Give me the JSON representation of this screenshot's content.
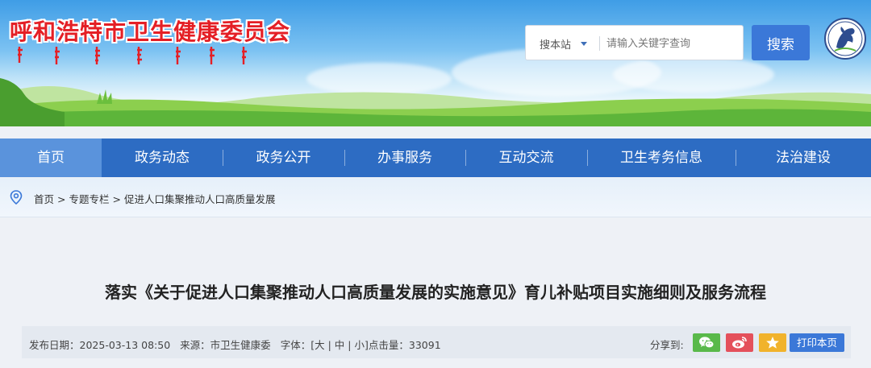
{
  "header": {
    "site_title": "呼和浩特市卫生健康委员会",
    "emblem_icon": "horse-emblem-icon"
  },
  "search": {
    "scope_label": "搜本站",
    "placeholder": "请输入关键字查询",
    "button_label": "搜索"
  },
  "nav": {
    "items": [
      {
        "label": "首页",
        "active": true
      },
      {
        "label": "政务动态"
      },
      {
        "label": "政务公开"
      },
      {
        "label": "办事服务"
      },
      {
        "label": "互动交流"
      },
      {
        "label": "卫生考务信息"
      },
      {
        "label": "法治建设"
      }
    ]
  },
  "breadcrumb": {
    "icon": "location-pin-icon",
    "items": [
      "首页",
      "专题专栏",
      "促进人口集聚推动人口高质量发展"
    ],
    "separator": ">"
  },
  "article": {
    "title": "落实《关于促进人口集聚推动人口高质量发展的实施意见》育儿补贴项目实施细则及服务流程",
    "meta": {
      "publish_label": "发布日期：",
      "publish_date": "2025-03-13 08:50",
      "source_label": "来源：",
      "source": "市卫生健康委",
      "font_label": "字体：",
      "font_large": "大",
      "font_medium": "中",
      "font_small": "小",
      "views_label": "点击量：",
      "views": "33091"
    },
    "share": {
      "label": "分享到:",
      "buttons": [
        {
          "icon": "wechat-icon",
          "color": "#59b94a"
        },
        {
          "icon": "weibo-icon",
          "color": "#e4505b"
        },
        {
          "icon": "qzone-star-icon",
          "color": "#f1b32c"
        }
      ],
      "print_label": "打印本页"
    }
  },
  "colors": {
    "nav_bg": "#2d6cc3",
    "nav_active": "#5a93dc",
    "title_red": "#e41f25",
    "button_blue": "#3b78d8"
  }
}
